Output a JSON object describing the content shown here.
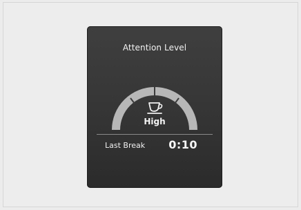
{
  "panel": {
    "title": "Attention Level",
    "level_label": "High",
    "level_icon": "coffee-cup-icon",
    "last_break_label": "Last Break",
    "last_break_value": "0:10"
  },
  "colors": {
    "background": "#ececec",
    "panel": "#383838",
    "gauge": "#b8b8b8",
    "text": "#f2f2f2"
  }
}
